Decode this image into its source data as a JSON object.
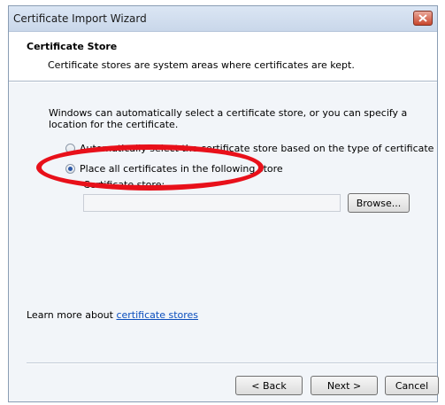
{
  "window": {
    "title": "Certificate Import Wizard"
  },
  "header": {
    "section_title": "Certificate Store",
    "section_desc": "Certificate stores are system areas where certificates are kept."
  },
  "content": {
    "intro": "Windows can automatically select a certificate store, or you can specify a location for the certificate.",
    "option_auto": {
      "label": "Automatically select the certificate store based on the type of certificate",
      "checked": false
    },
    "option_place": {
      "label": "Place all certificates in the following store",
      "checked": true
    },
    "store_label": "Certificate store:",
    "store_value": "",
    "browse_label": "Browse...",
    "learn_more_prefix": "Learn more about ",
    "learn_more_link": "certificate stores"
  },
  "footer": {
    "back_label": "< Back",
    "next_label": "Next >",
    "cancel_label": "Cancel"
  },
  "colors": {
    "annotation": "#e8101a",
    "link": "#0b4ebd"
  },
  "icons": {
    "close": "close-icon"
  }
}
